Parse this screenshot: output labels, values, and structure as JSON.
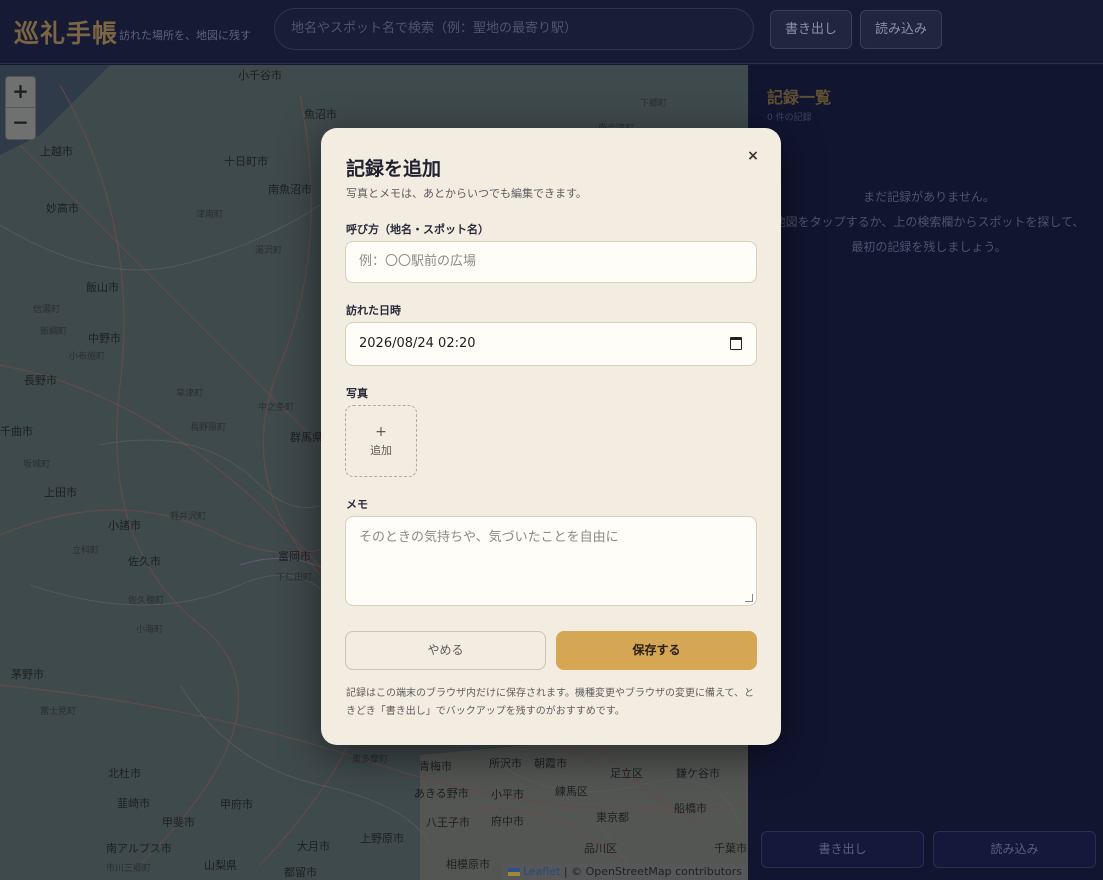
{
  "header": {
    "brand": "巡礼手帳",
    "tagline": "訪れた場所を、地図に残す",
    "search_placeholder": "地名やスポット名で検索（例：聖地の最寄り駅）",
    "export_label": "書き出し",
    "import_label": "読み込み"
  },
  "map": {
    "zoom_in": "+",
    "zoom_out": "−",
    "attribution_link": "Leaflet",
    "attribution_text": " | © OpenStreetMap contributors",
    "places": [
      {
        "name": "小千谷市"
      },
      {
        "name": "魚沼市"
      },
      {
        "name": "上越市"
      },
      {
        "name": "十日町市"
      },
      {
        "name": "南魚沼市"
      },
      {
        "name": "妙高市"
      },
      {
        "name": "津南町"
      },
      {
        "name": "湯沢町"
      },
      {
        "name": "飯山市"
      },
      {
        "name": "信濃町"
      },
      {
        "name": "飯綱町"
      },
      {
        "name": "中野市"
      },
      {
        "name": "小布施町"
      },
      {
        "name": "長野市"
      },
      {
        "name": "草津町"
      },
      {
        "name": "中之条町"
      },
      {
        "name": "長野原町"
      },
      {
        "name": "千曲市"
      },
      {
        "name": "坂城町"
      },
      {
        "name": "群馬県"
      },
      {
        "name": "上田市"
      },
      {
        "name": "軽井沢町"
      },
      {
        "name": "小諸市"
      },
      {
        "name": "立科町"
      },
      {
        "name": "佐久市"
      },
      {
        "name": "富岡市"
      },
      {
        "name": "下仁田町"
      },
      {
        "name": "佐久穂町"
      },
      {
        "name": "小海町"
      },
      {
        "name": "茅野市"
      },
      {
        "name": "富士見町"
      },
      {
        "name": "北杜市"
      },
      {
        "name": "韮崎市"
      },
      {
        "name": "甲府市"
      },
      {
        "name": "甲斐市"
      },
      {
        "name": "南アルプス市"
      },
      {
        "name": "市川三郷町"
      },
      {
        "name": "山梨県"
      },
      {
        "name": "大月市"
      },
      {
        "name": "都留市"
      },
      {
        "name": "上野原市"
      },
      {
        "name": "相模原市"
      },
      {
        "name": "八王子市"
      },
      {
        "name": "あきる野市"
      },
      {
        "name": "青梅市"
      },
      {
        "name": "所沢市"
      },
      {
        "name": "朝霞市"
      },
      {
        "name": "小平市"
      },
      {
        "name": "府中市"
      },
      {
        "name": "練馬区"
      },
      {
        "name": "足立区"
      },
      {
        "name": "鎌ケ谷市"
      },
      {
        "name": "船橋市"
      },
      {
        "name": "東京都"
      },
      {
        "name": "品川区"
      },
      {
        "name": "千葉市"
      },
      {
        "name": "奥多摩町"
      },
      {
        "name": "下郷町"
      },
      {
        "name": "南会津町"
      }
    ]
  },
  "panel": {
    "title": "記録一覧",
    "count": "0 件の記録",
    "empty_line1": "まだ記録がありません。",
    "empty_line2": "地図をタップするか、上の検索欄からスポットを探して、",
    "empty_line3": "最初の記録を残しましょう。",
    "export_label": "書き出し",
    "import_label": "読み込み"
  },
  "modal": {
    "title": "記録を追加",
    "close": "×",
    "subtitle": "写真とメモは、あとからいつでも編集できます。",
    "name_label": "呼び方（地名・スポット名）",
    "name_placeholder": "例：〇〇駅前の広場",
    "date_label": "訪れた日時",
    "date_value": "2026/08/24 02:20",
    "photo_label": "写真",
    "photo_plus": "+",
    "photo_add": "追加",
    "memo_label": "メモ",
    "memo_placeholder": "そのときの気持ちや、気づいたことを自由に",
    "cancel_label": "やめる",
    "save_label": "保存する",
    "note": "記録はこの端末のブラウザ内だけに保存されます。機種変更やブラウザの変更に備えて、ときどき「書き出し」でバックアップを残すのがおすすめです。"
  }
}
